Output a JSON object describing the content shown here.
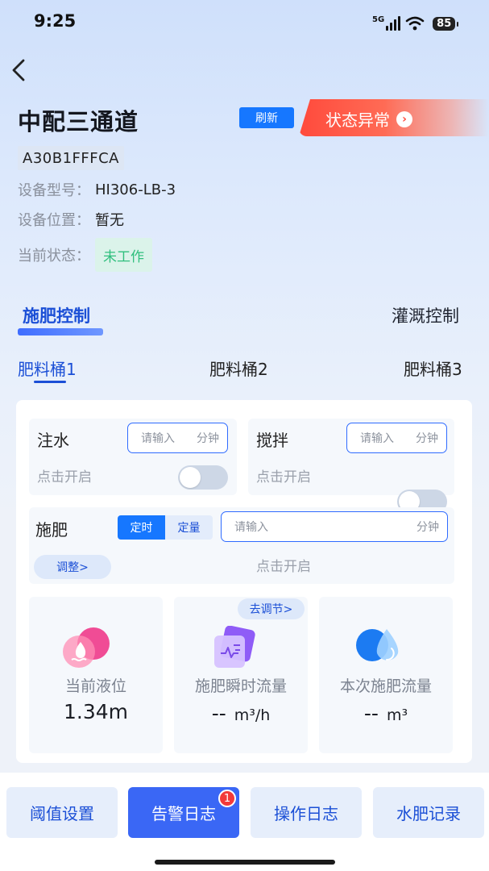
{
  "status_bar": {
    "time": "9:25",
    "network": "5G",
    "battery": "85"
  },
  "header": {
    "title": "中配三通道",
    "refresh_label": "刷新",
    "alarm_label": "状态异常",
    "alarm_arrow": "›"
  },
  "device": {
    "id": "A30B1FFFCA",
    "model_label": "设备型号：",
    "model_value": "HI306-LB-3",
    "location_label": "设备位置：",
    "location_value": "暂无",
    "state_label": "当前状态：",
    "state_value": "未工作"
  },
  "main_tabs": [
    {
      "label": "施肥控制",
      "active": true
    },
    {
      "label": "灌溉控制",
      "active": false
    }
  ],
  "bucket_tabs": [
    {
      "label": "肥料桶1",
      "active": true
    },
    {
      "label": "肥料桶2",
      "active": false
    },
    {
      "label": "肥料桶3",
      "active": false
    }
  ],
  "controls": {
    "water": {
      "label": "注水",
      "placeholder": "请输入",
      "unit": "分钟",
      "toggle_label": "点击开启",
      "on": false
    },
    "stir": {
      "label": "搅拌",
      "placeholder": "请输入",
      "unit": "分钟",
      "toggle_label": "点击开启",
      "on": false
    },
    "fertilize": {
      "label": "施肥",
      "mode_timed": "定时",
      "mode_quantity": "定量",
      "mode_selected": "定时",
      "placeholder": "请输入",
      "unit": "分钟",
      "adjust_label": "调整>",
      "toggle_label": "点击开启",
      "on": false
    }
  },
  "stats": {
    "adjust_label": "去调节>",
    "level": {
      "label": "当前液位",
      "value": "1.34m"
    },
    "flow_rate": {
      "label": "施肥瞬时流量",
      "value": "--",
      "unit": "m³/h"
    },
    "flow_total": {
      "label": "本次施肥流量",
      "value": "--",
      "unit": "m³"
    }
  },
  "bottom_buttons": [
    {
      "label": "阈值设置"
    },
    {
      "label": "告警日志",
      "badge": "1"
    },
    {
      "label": "操作日志"
    },
    {
      "label": "水肥记录"
    }
  ],
  "colors": {
    "primary": "#1677ff",
    "accent": "#1b4fd6",
    "alarm": "#ff4a3c",
    "state_ok": "#2fbf7d"
  }
}
